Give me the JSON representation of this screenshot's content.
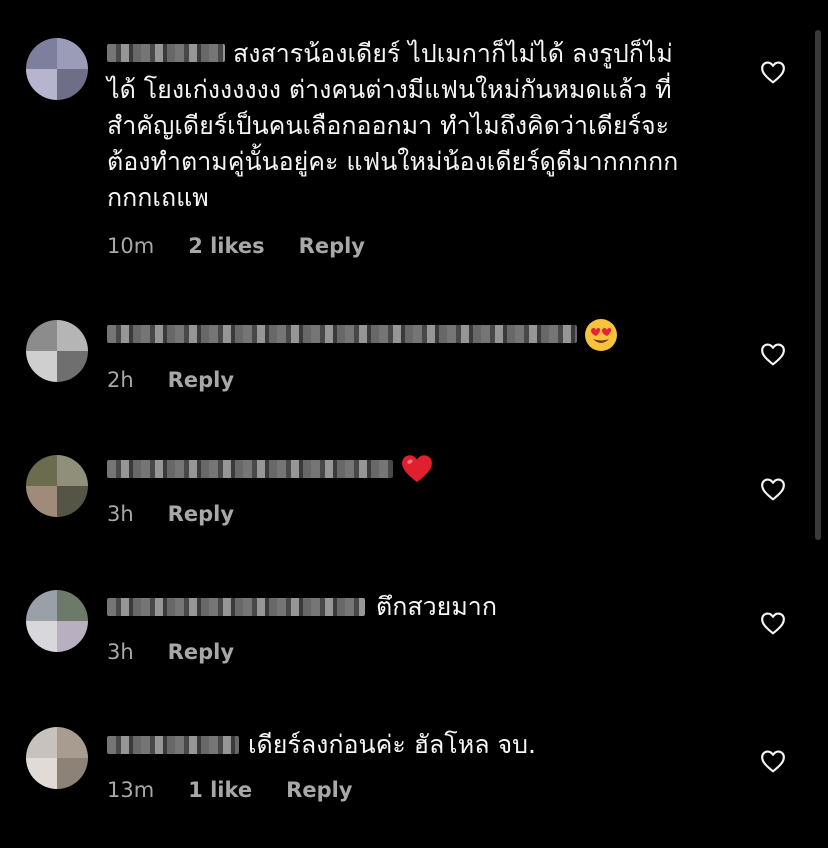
{
  "comments": [
    {
      "text": "สงสารน้องเดียร์ ไปเมกาก็ไม่ได้ ลงรูปก็ไม่\nได้ โยงเก่งงงงงง ต่างคนต่างมีแฟนใหม่กันหมดแล้ว ที่\nสำคัญเดียร์เป็นคนเลือกออกมา ทำไมถึงคิดว่าเดียร์จะ\nต้องทำตามคู่นั้นอยู่คะ แฟนใหม่น้องเดียร์ดูดีมากกกกก\nกกกเถแพ",
      "time": "10m",
      "likes": "2 likes",
      "reply": "Reply"
    },
    {
      "text": "",
      "emoji": "smiling-face-with-heart-eyes",
      "time": "2h",
      "reply": "Reply"
    },
    {
      "text": "",
      "emoji": "red-heart",
      "time": "3h",
      "reply": "Reply"
    },
    {
      "text": "ตึกสวยมาก",
      "time": "3h",
      "reply": "Reply"
    },
    {
      "text": "เดียร์ลงก่อนค่ะ ฮัลโหล จบ.",
      "time": "13m",
      "likes": "1 like",
      "reply": "Reply"
    }
  ],
  "colors": {
    "background": "#000000",
    "text": "#f5f5f5",
    "meta": "#a8a8a8"
  }
}
